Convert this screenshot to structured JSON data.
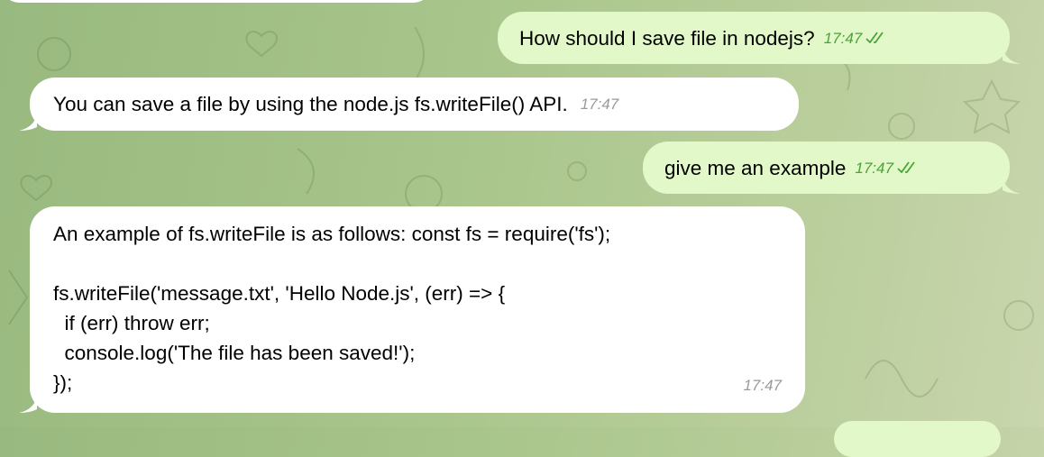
{
  "messages": [
    {
      "side": "out",
      "text": "How should I save file in nodejs?",
      "time": "17:47",
      "status": "read-double-check"
    },
    {
      "side": "in",
      "text": "You can save a file by using the node.js fs.writeFile() API.",
      "time": "17:47"
    },
    {
      "side": "out",
      "text": "give me an example",
      "time": "17:47",
      "status": "read-double-check"
    },
    {
      "side": "in",
      "text": "An example of fs.writeFile is as follows: const fs = require('fs');\n\nfs.writeFile('message.txt', 'Hello Node.js', (err) => {\n  if (err) throw err;\n  console.log('The file has been saved!');\n});",
      "time": "17:47"
    }
  ],
  "colors": {
    "outgoing": "#e2f8c8",
    "incoming": "#ffffff",
    "check": "#4aa43a"
  }
}
